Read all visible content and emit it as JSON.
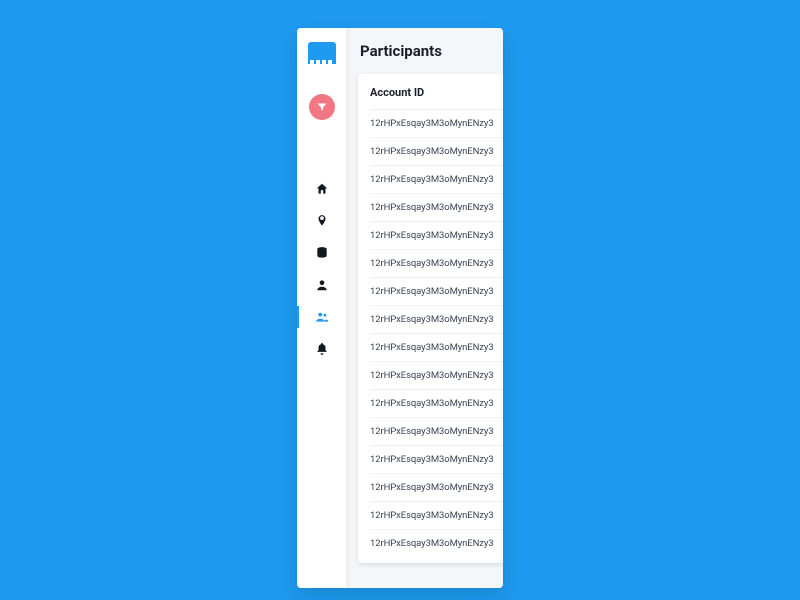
{
  "page": {
    "title": "Participants"
  },
  "table": {
    "column_header": "Account ID",
    "rows": [
      "12rHPxEsqay3M3oMynENzy3",
      "12rHPxEsqay3M3oMynENzy3",
      "12rHPxEsqay3M3oMynENzy3",
      "12rHPxEsqay3M3oMynENzy3",
      "12rHPxEsqay3M3oMynENzy3",
      "12rHPxEsqay3M3oMynENzy3",
      "12rHPxEsqay3M3oMynENzy3",
      "12rHPxEsqay3M3oMynENzy3",
      "12rHPxEsqay3M3oMynENzy3",
      "12rHPxEsqay3M3oMynENzy3",
      "12rHPxEsqay3M3oMynENzy3",
      "12rHPxEsqay3M3oMynENzy3",
      "12rHPxEsqay3M3oMynENzy3",
      "12rHPxEsqay3M3oMynENzy3",
      "12rHPxEsqay3M3oMynENzy3",
      "12rHPxEsqay3M3oMynENzy3"
    ]
  },
  "sidebar": {
    "filter_icon": "filter",
    "items": [
      {
        "name": "home",
        "active": false
      },
      {
        "name": "location",
        "active": false
      },
      {
        "name": "database",
        "active": false
      },
      {
        "name": "user",
        "active": false
      },
      {
        "name": "participants",
        "active": true
      },
      {
        "name": "notifications",
        "active": false
      }
    ]
  }
}
